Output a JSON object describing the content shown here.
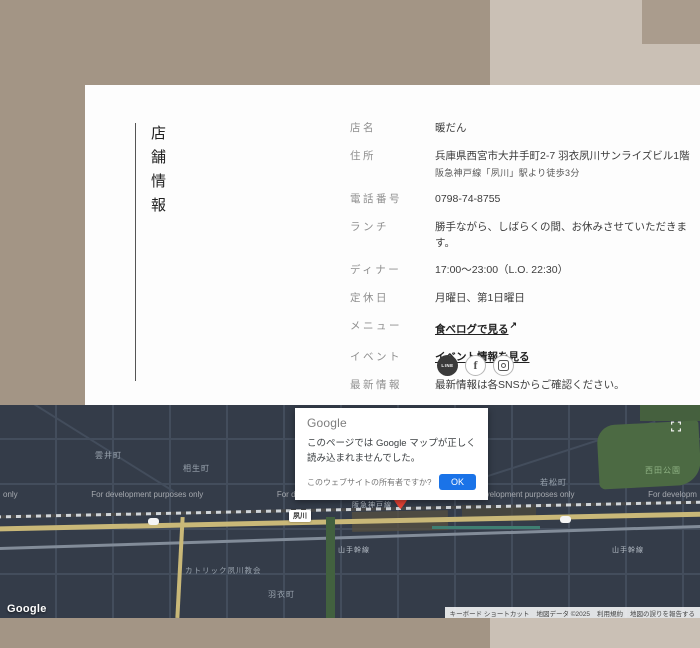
{
  "page": {
    "colors": {
      "bg_left": "#a39585",
      "bg_right": "#cac0b5",
      "card_bg": "#fdfdfd",
      "accent_blue": "#1a73e8",
      "map_bg": "#343c49",
      "pin_red": "#e94335",
      "road_yellow": "#c9b878",
      "park_green": "#4c6a43"
    }
  },
  "store_info": {
    "section_title": "店舗情報",
    "rows": [
      {
        "label": "店名",
        "value": "暖だん"
      },
      {
        "label": "住所",
        "value": "兵庫県西宮市大井手町2-7 羽衣夙川サンライズビル1階",
        "note": "阪急神戸線「夙川」駅より徒歩3分"
      },
      {
        "label": "電話番号",
        "value": "0798-74-8755"
      },
      {
        "label": "ランチ",
        "value": "勝手ながら、しばらくの間、お休みさせていただきます。"
      },
      {
        "label": "ディナー",
        "value": "17:00〜23:00（L.O. 22:30）"
      },
      {
        "label": "定休日",
        "value": "月曜日、第1日曜日"
      },
      {
        "label": "メニュー",
        "value": "食べログで見る",
        "external_icon": "↗"
      },
      {
        "label": "イベント",
        "value": "イベント情報を見る"
      },
      {
        "label": "最新情報",
        "value": "最新情報は各SNSからご確認ください。"
      }
    ],
    "sns_icons": [
      "line",
      "facebook",
      "instagram"
    ]
  },
  "map": {
    "dialog": {
      "logo": "Google",
      "message": "このページでは Google マップが正しく読み込まれませんでした。",
      "owner_link": "このウェブサイトの所有者ですか?",
      "ok_label": "OK"
    },
    "watermarks": {
      "left_partial": "only",
      "full": "For development purposes only",
      "right_partial": "For developm"
    },
    "labels": {
      "kumoi": "雲井町",
      "aioi": "相生町",
      "wakamatsu": "若松町",
      "nishida_park": "西田公園",
      "station": "夙川",
      "rail_line": "阪急神戸線",
      "yamate_left": "山手幹線",
      "yamate_right": "山手幹線",
      "church": "カトリック夙川教会",
      "hagoromo": "羽衣町"
    },
    "google_logo": "Google",
    "footer": {
      "shortcuts": "キーボード ショートカット",
      "map_data": "地図データ ©2025",
      "terms": "利用規約",
      "report": "地図の誤りを報告する"
    }
  }
}
